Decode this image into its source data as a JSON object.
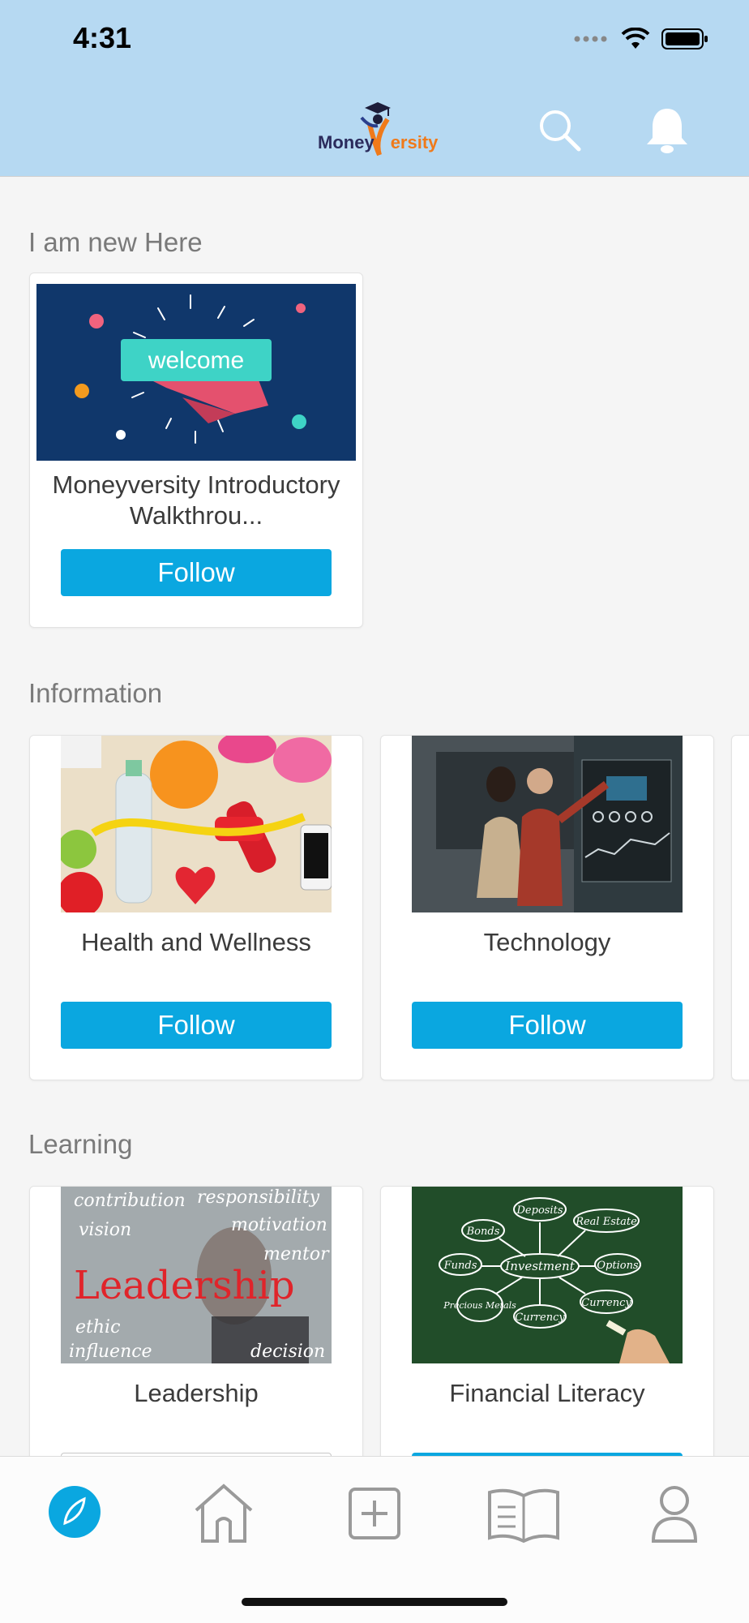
{
  "status_bar": {
    "time": "4:31"
  },
  "header": {
    "logo_text_a": "Money",
    "logo_text_b": "ersity",
    "search_icon": "search-icon",
    "bell_icon": "bell-icon"
  },
  "sections": [
    {
      "title": "I am new Here",
      "cards": [
        {
          "title": "Moneyversity Introductory Walkthrou...",
          "button": "Follow",
          "image_text": "welcome"
        }
      ]
    },
    {
      "title": "Information",
      "cards": [
        {
          "title": "Health and Wellness",
          "button": "Follow"
        },
        {
          "title": "Technology",
          "button": "Follow"
        }
      ]
    },
    {
      "title": "Learning",
      "cards": [
        {
          "title": "Leadership",
          "button": "",
          "image_words": [
            "contribution",
            "responsibility",
            "vision",
            "motivation",
            "mentor",
            "Leadership",
            "ethic",
            "influence",
            "decision"
          ]
        },
        {
          "title": "Financial Literacy",
          "button": "",
          "image_words": [
            "Deposits",
            "Bonds",
            "Real Estate",
            "Funds",
            "Investment",
            "Options",
            "Precious Metals",
            "Currency",
            "Currency"
          ]
        }
      ]
    }
  ],
  "tabbar": {
    "items": [
      "explore-icon",
      "home-icon",
      "add-icon",
      "book-icon",
      "profile-icon"
    ],
    "active_color": "#0aa7e0"
  }
}
